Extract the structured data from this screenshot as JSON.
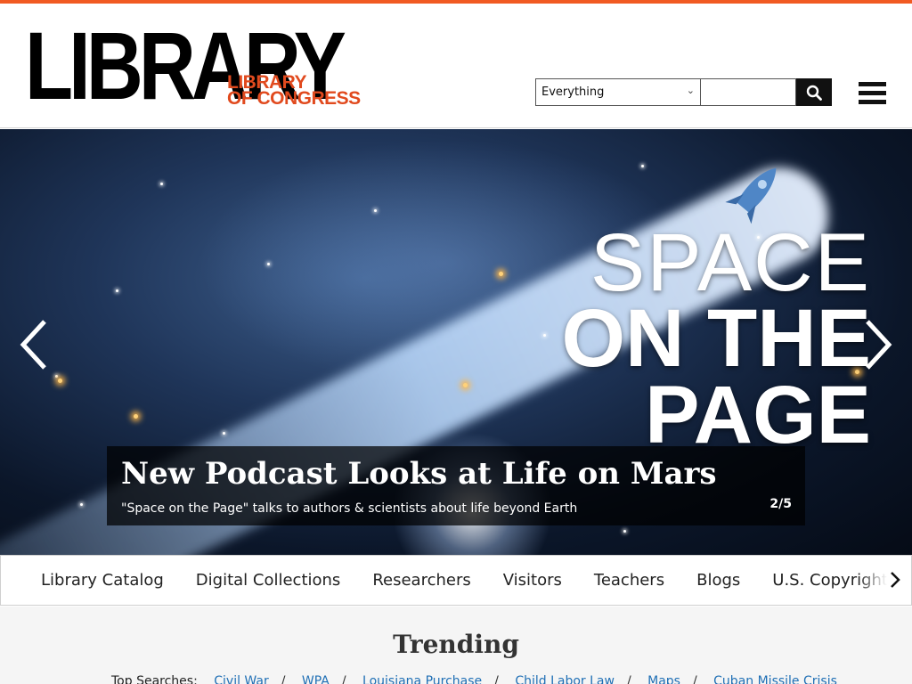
{
  "header": {
    "logo_main": "LIBRARY",
    "logo_sub_line1": "LIBRARY",
    "logo_sub_line2": "OF CONGRESS",
    "accent_color": "#f15a22"
  },
  "search": {
    "scope_selected": "Everything",
    "query_value": "",
    "submit_icon": "search-icon"
  },
  "menu_icon": "hamburger-menu-icon",
  "hero": {
    "banner_line1": "SPACE",
    "banner_line2": "ON THE",
    "banner_line3": "PAGE",
    "headline": "New Podcast Looks at Life on Mars",
    "description": "\"Space on the Page\" talks to authors & scientists about life beyond Earth",
    "counter": "2/5",
    "prev_icon": "chevron-left-icon",
    "next_icon": "chevron-right-icon"
  },
  "nav": {
    "items": [
      "Library Catalog",
      "Digital Collections",
      "Researchers",
      "Visitors",
      "Teachers",
      "Blogs",
      "U.S. Copyright Office"
    ],
    "scroll_icon": "chevron-right-icon"
  },
  "trending": {
    "title": "Trending",
    "label": "Top Searches:",
    "searches": [
      "Civil War",
      "WPA",
      "Louisiana Purchase",
      "Child Labor Law",
      "Maps",
      "Cuban Missile Crisis"
    ]
  }
}
